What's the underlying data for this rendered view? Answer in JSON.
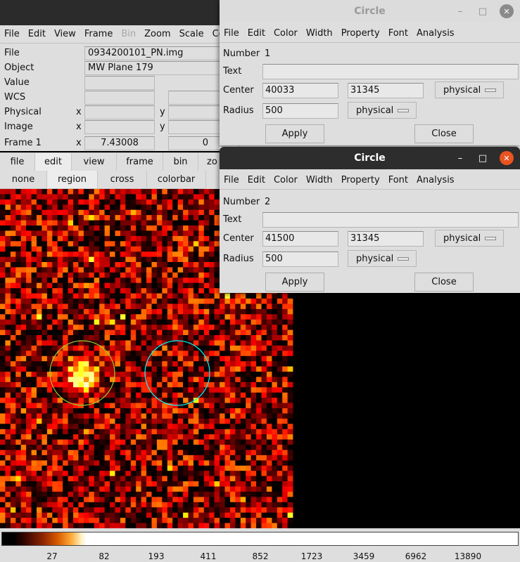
{
  "main": {
    "menu": [
      "File",
      "Edit",
      "View",
      "Frame",
      "Bin",
      "Zoom",
      "Scale",
      "Co"
    ],
    "menu_disabled_index": 4,
    "info": {
      "file_label": "File",
      "file_value": "0934200101_PN.img",
      "object_label": "Object",
      "object_value": "MW Plane 179",
      "value_label": "Value",
      "wcs_label": "WCS",
      "physical_label": "Physical",
      "image_label": "Image",
      "frame_label": "Frame 1",
      "x_label": "x",
      "y_label": "y",
      "zoom_value": "7.43008",
      "angle_value": "0"
    },
    "buttonbar_top": [
      "file",
      "edit",
      "view",
      "frame",
      "bin",
      "zo"
    ],
    "buttonbar_top_active": "edit",
    "buttonbar_bottom": [
      "none",
      "region",
      "cross",
      "colorbar"
    ],
    "buttonbar_bottom_active": "region",
    "colors": {
      "region_selected": "#9acd32",
      "region_other": "#00ffff"
    },
    "colorbar_ticks": [
      "27",
      "82",
      "193",
      "411",
      "852",
      "1723",
      "3459",
      "6962",
      "13890"
    ]
  },
  "dialog1": {
    "title": "Circle",
    "menu": [
      "File",
      "Edit",
      "Color",
      "Width",
      "Property",
      "Font",
      "Analysis"
    ],
    "number_label": "Number",
    "number_value": "1",
    "text_label": "Text",
    "text_value": "",
    "center_label": "Center",
    "center_x": "40033",
    "center_y": "31345",
    "center_system": "physical",
    "radius_label": "Radius",
    "radius_value": "500",
    "radius_units": "physical",
    "apply_label": "Apply",
    "close_label": "Close"
  },
  "dialog2": {
    "title": "Circle",
    "menu": [
      "File",
      "Edit",
      "Color",
      "Width",
      "Property",
      "Font",
      "Analysis"
    ],
    "number_label": "Number",
    "number_value": "2",
    "text_label": "Text",
    "text_value": "",
    "center_label": "Center",
    "center_x": "41500",
    "center_y": "31345",
    "center_system": "physical",
    "radius_label": "Radius",
    "radius_value": "500",
    "radius_units": "physical",
    "apply_label": "Apply",
    "close_label": "Close"
  }
}
